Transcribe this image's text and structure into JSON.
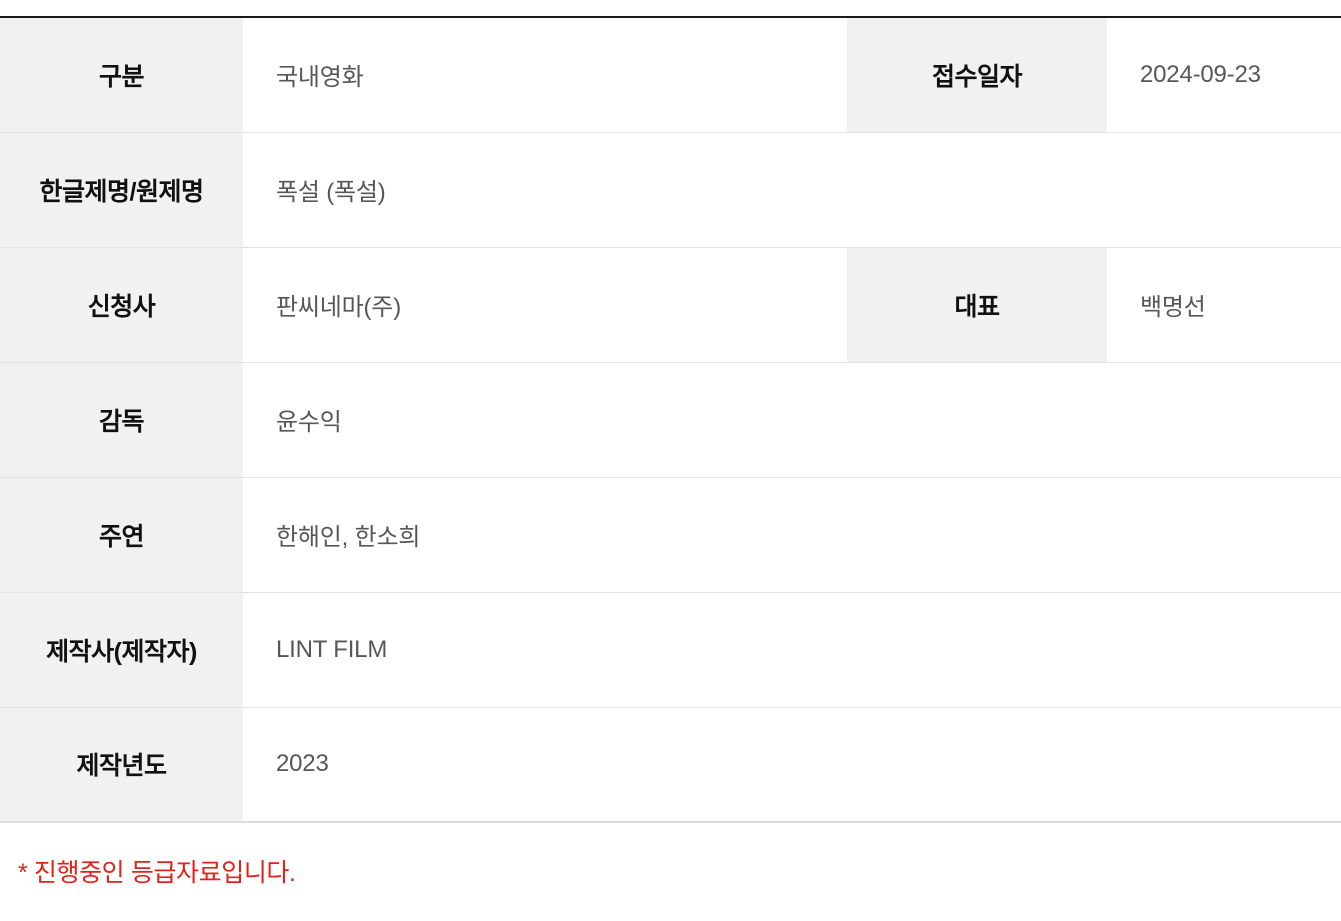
{
  "table": {
    "rows": [
      {
        "label": "구분",
        "value": "국내영화",
        "label2": "접수일자",
        "value2": "2024-09-23",
        "has_second_pair": true
      },
      {
        "label": "한글제명/원제명",
        "value": "폭설  (폭설)",
        "label2": "",
        "value2": "",
        "has_second_pair": false
      },
      {
        "label": "신청사",
        "value": "판씨네마(주)",
        "label2": "대표",
        "value2": "백명선",
        "has_second_pair": true
      },
      {
        "label": "감독",
        "value": "윤수익",
        "label2": "",
        "value2": "",
        "has_second_pair": false
      },
      {
        "label": "주연",
        "value": "한해인, 한소희",
        "label2": "",
        "value2": "",
        "has_second_pair": false
      },
      {
        "label": "제작사(제작자)",
        "value": "LINT FILM",
        "label2": "",
        "value2": "",
        "has_second_pair": false
      },
      {
        "label": "제작년도",
        "value": "2023",
        "label2": "",
        "value2": "",
        "has_second_pair": false
      }
    ]
  },
  "footer": {
    "note": "* 진행중인 등급자료입니다."
  },
  "colors": {
    "label_background": "#f1f1f1",
    "label_text": "#111111",
    "value_text": "#575757",
    "row_divider": "#e2e2e2",
    "table_top_border": "#1a1a1a",
    "table_bottom_border": "#dcdcdc",
    "note_text": "#e32119",
    "page_background": "#ffffff"
  }
}
